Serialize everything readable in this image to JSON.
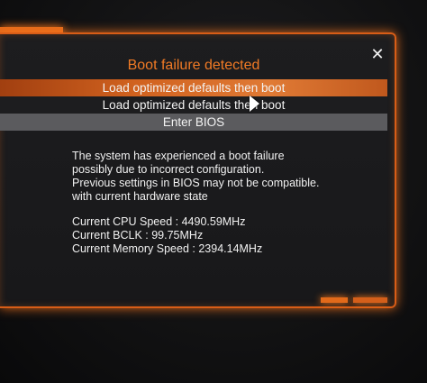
{
  "dialog": {
    "title": "Boot failure detected",
    "close_icon": "close-icon",
    "options": [
      {
        "label": "Load optimized defaults then boot",
        "state": "highlighted"
      },
      {
        "label": "Load optimized defaults then boot",
        "state": "normal"
      },
      {
        "label": "Enter BIOS",
        "state": "selected"
      }
    ],
    "message": [
      "The system has experienced a boot failure",
      "possibly due to incorrect configuration.",
      "Previous settings in BIOS may not be compatible.",
      "with current hardware state"
    ],
    "stats": [
      "Current CPU Speed : 4490.59MHz",
      "Current BCLK : 99.75MHz",
      "Current Memory Speed : 2394.14MHz"
    ]
  },
  "colors": {
    "accent": "#e26a1a",
    "title": "#f07a25",
    "highlight": "#d1621f",
    "selected": "#5b5b5e",
    "text": "#f1f1f1",
    "background": "#18181a"
  }
}
